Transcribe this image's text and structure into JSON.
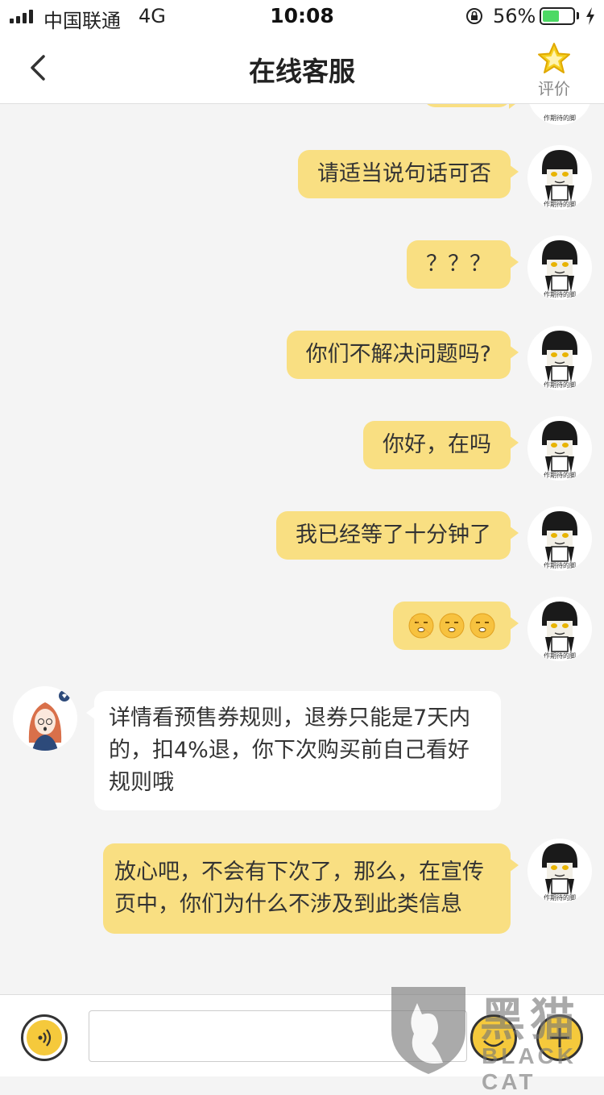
{
  "status_bar": {
    "carrier": "中国联通",
    "network": "4G",
    "time": "10:08",
    "battery_percent": "56%",
    "battery_level": 0.56
  },
  "nav": {
    "title": "在线客服",
    "rate_label": "评价"
  },
  "messages": [
    {
      "side": "right",
      "text": "请适当说句话可否"
    },
    {
      "side": "right",
      "text": "？？？"
    },
    {
      "side": "right",
      "text": "你们不解决问题吗?"
    },
    {
      "side": "right",
      "text": "你好，在吗"
    },
    {
      "side": "right",
      "text": "我已经等了十分钟了"
    },
    {
      "side": "right",
      "type": "emoji",
      "emoji": [
        "face-emoji",
        "face-emoji",
        "face-emoji"
      ]
    },
    {
      "side": "left",
      "text": "详情看预售券规则，退券只能是7天内的，扣4%退，你下次购买前自己看好规则哦"
    },
    {
      "side": "right",
      "text": "放心吧，不会有下次了，那么，在宣传页中，你们为什么不涉及到此类信息"
    }
  ],
  "avatar_caption": "作期待的脚",
  "watermark": {
    "big": "黑猫",
    "small": "BLACK CAT"
  },
  "colors": {
    "bubble_user": "#f9df82",
    "bubble_agent": "#ffffff",
    "accent": "#f5c93c",
    "background": "#f4f4f4"
  }
}
